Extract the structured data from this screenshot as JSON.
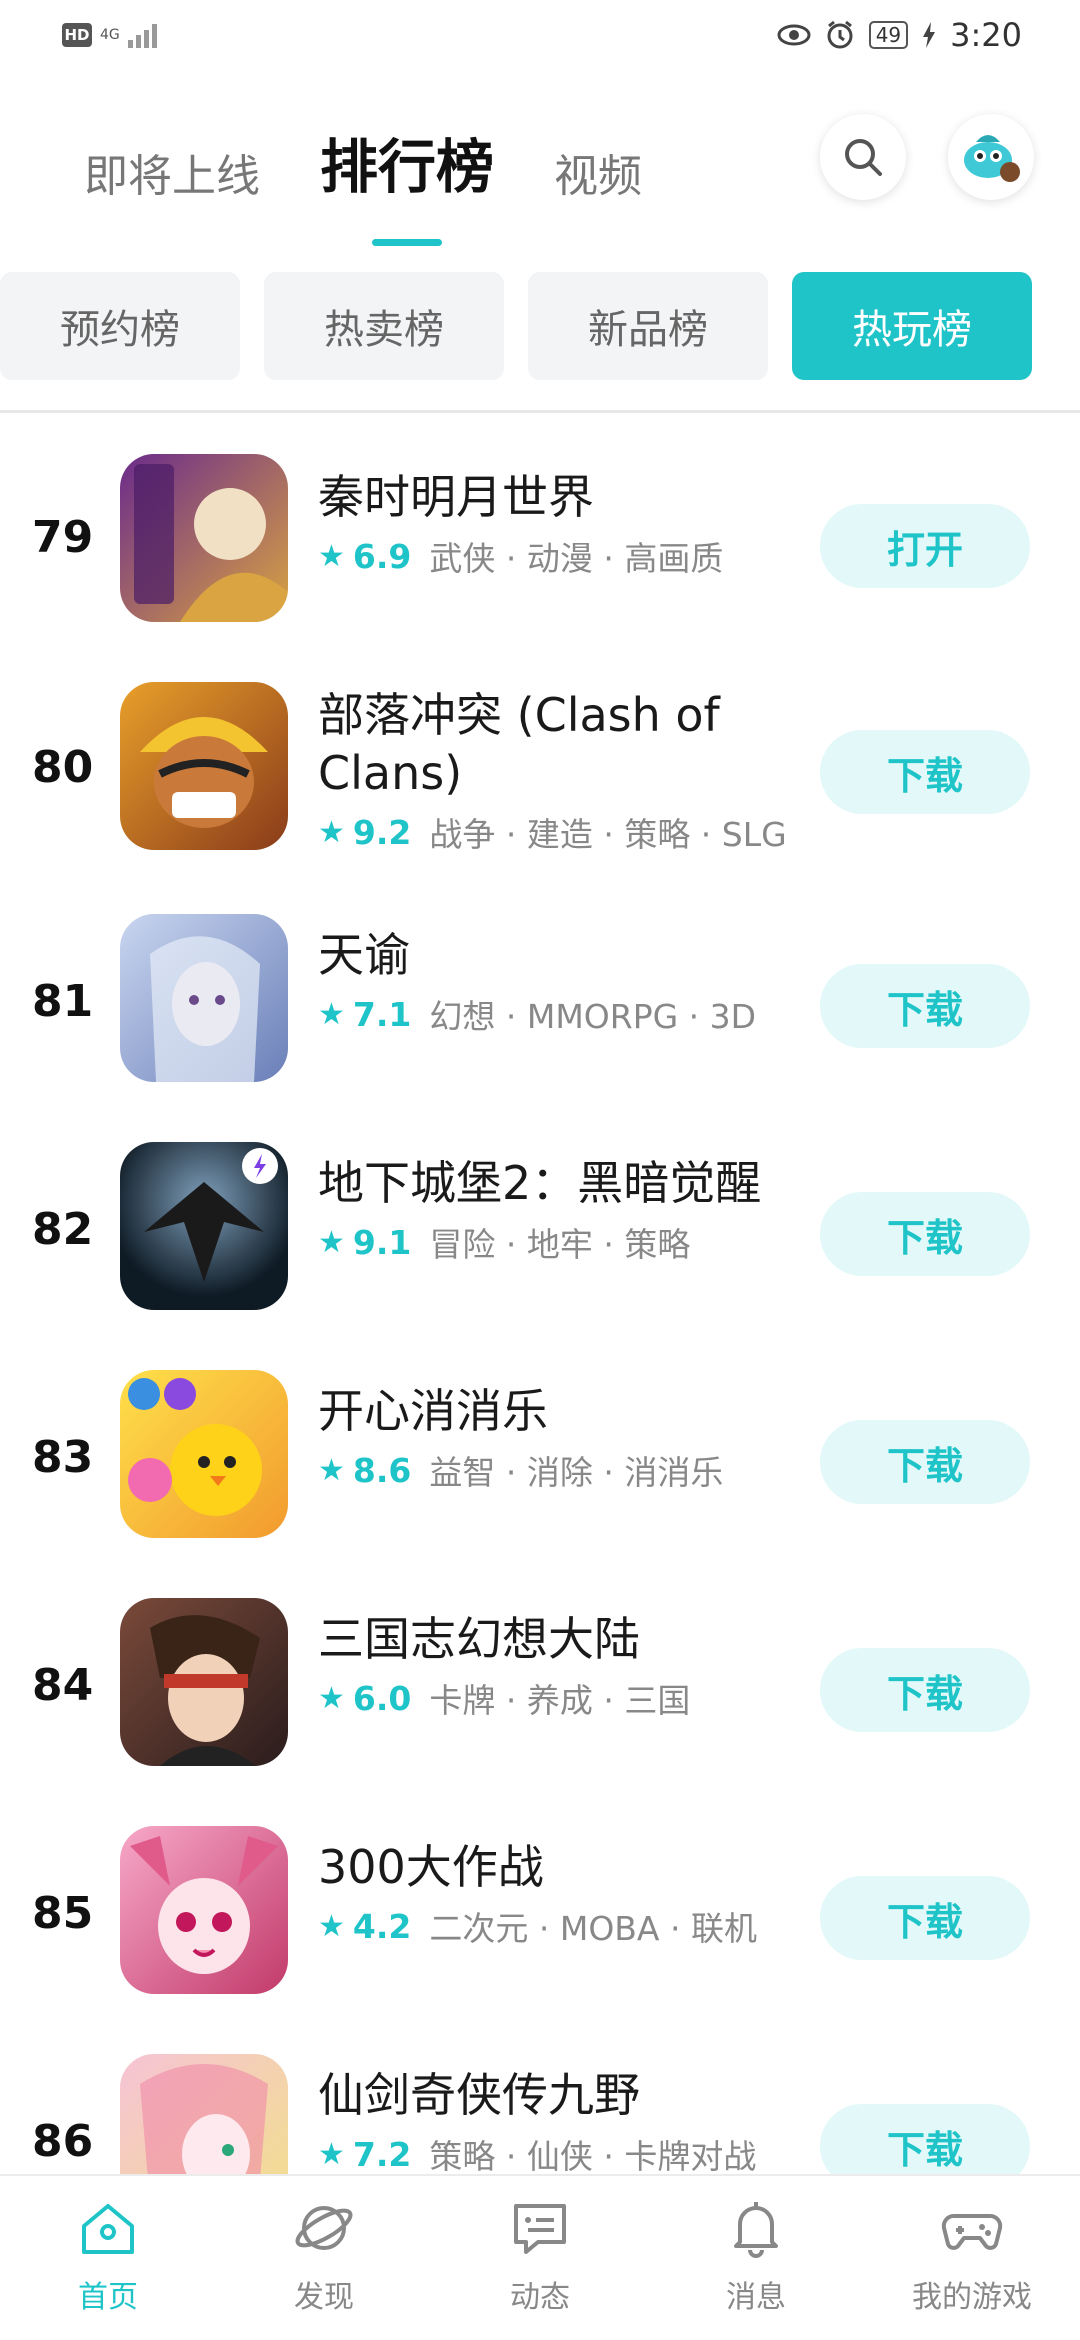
{
  "status_bar": {
    "hd": "HD",
    "network": "4G",
    "battery": "49",
    "time": "3:20"
  },
  "header": {
    "tabs": [
      {
        "label": "即将上线",
        "active": false
      },
      {
        "label": "排行榜",
        "active": true
      },
      {
        "label": "视频",
        "active": false
      }
    ],
    "search_icon": "search-icon",
    "avatar_icon": "user-avatar"
  },
  "chips": [
    {
      "label": "预约榜",
      "active": false
    },
    {
      "label": "热卖榜",
      "active": false
    },
    {
      "label": "新品榜",
      "active": false
    },
    {
      "label": "热玩榜",
      "active": true
    }
  ],
  "games": [
    {
      "rank": "79",
      "name": "秦时明月世界",
      "score": "6.9",
      "tags": "武侠 · 动漫 · 高画质",
      "action": "打开",
      "colors": [
        "#6b2a8c",
        "#d9a441"
      ]
    },
    {
      "rank": "80",
      "name": "部落冲突 (Clash of Clans)",
      "score": "9.2",
      "tags": "战争 · 建造 · 策略 · SLG",
      "action": "下载",
      "colors": [
        "#e8a02a",
        "#8a3b1a"
      ]
    },
    {
      "rank": "81",
      "name": "天谕",
      "score": "7.1",
      "tags": "幻想 · MMORPG · 3D",
      "action": "下载",
      "colors": [
        "#c9d6f0",
        "#6a7fb8"
      ]
    },
    {
      "rank": "82",
      "name": "地下城堡2：黑暗觉醒",
      "score": "9.1",
      "tags": "冒险 · 地牢 · 策略",
      "action": "下载",
      "colors": [
        "#3d5a73",
        "#0e1a24"
      ]
    },
    {
      "rank": "83",
      "name": "开心消消乐",
      "score": "8.6",
      "tags": "益智 · 消除 · 消消乐",
      "action": "下载",
      "colors": [
        "#ffe04a",
        "#f29a2e"
      ]
    },
    {
      "rank": "84",
      "name": "三国志幻想大陆",
      "score": "6.0",
      "tags": "卡牌 · 养成 · 三国",
      "action": "下载",
      "colors": [
        "#7a4a3a",
        "#2a1c1c"
      ]
    },
    {
      "rank": "85",
      "name": "300大作战",
      "score": "4.2",
      "tags": "二次元 · MOBA · 联机",
      "action": "下载",
      "colors": [
        "#f7a8c8",
        "#c23a6a"
      ]
    },
    {
      "rank": "86",
      "name": "仙剑奇侠传九野",
      "score": "7.2",
      "tags": "策略 · 仙侠 · 卡牌对战",
      "action": "下载",
      "colors": [
        "#f6c3d6",
        "#f2e08a"
      ]
    }
  ],
  "bottom_nav": [
    {
      "label": "首页",
      "icon": "home-icon",
      "active": true
    },
    {
      "label": "发现",
      "icon": "planet-icon",
      "active": false
    },
    {
      "label": "动态",
      "icon": "message-board-icon",
      "active": false
    },
    {
      "label": "消息",
      "icon": "bell-icon",
      "active": false
    },
    {
      "label": "我的游戏",
      "icon": "gamepad-icon",
      "active": false
    }
  ]
}
